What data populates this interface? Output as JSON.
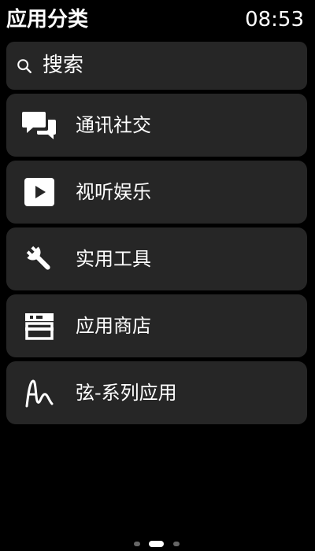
{
  "header": {
    "title": "应用分类",
    "time": "08:53"
  },
  "search": {
    "label": "搜索",
    "icon": "search-icon"
  },
  "categories": [
    {
      "label": "通讯社交",
      "icon": "chat-bubbles-icon"
    },
    {
      "label": "视听娱乐",
      "icon": "play-icon"
    },
    {
      "label": "实用工具",
      "icon": "wrench-icon"
    },
    {
      "label": "应用商店",
      "icon": "store-icon"
    },
    {
      "label": "弦-系列应用",
      "icon": "xian-logo-icon"
    }
  ],
  "pager": {
    "pages": 3,
    "current_page": 2
  },
  "colors": {
    "background": "#000000",
    "card": "#262626",
    "text": "#ffffff",
    "inactive_dot": "#666666"
  }
}
